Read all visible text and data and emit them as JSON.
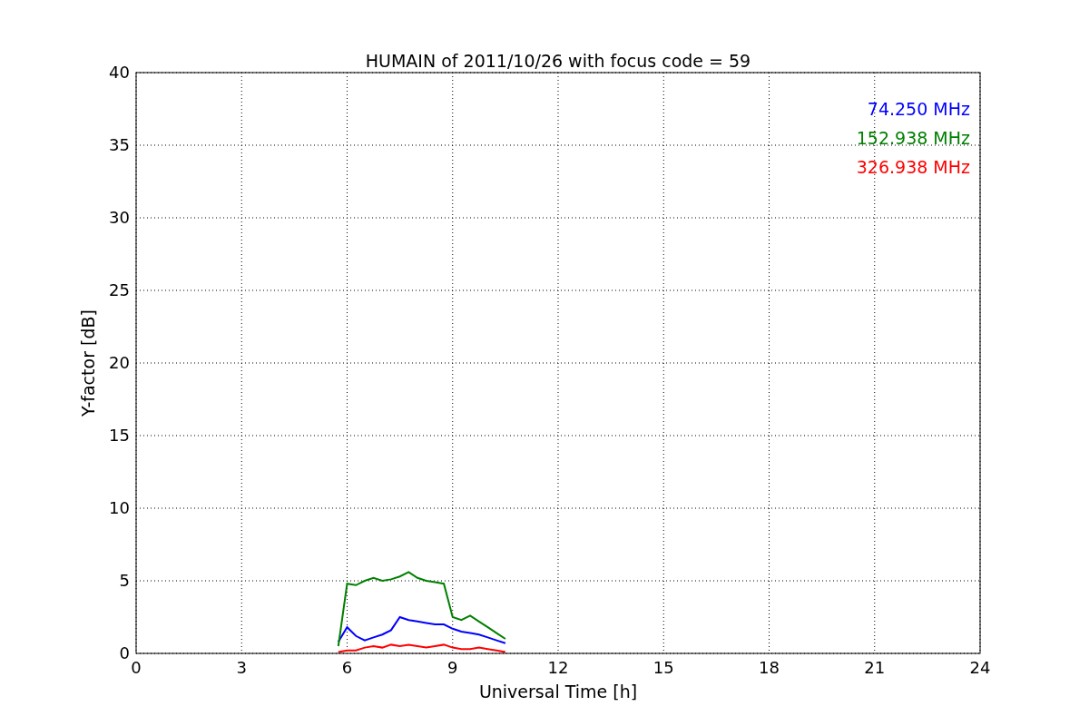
{
  "chart_data": {
    "type": "line",
    "title": "HUMAIN of 2011/10/26 with focus code = 59",
    "xlabel": "Universal Time [h]",
    "ylabel": "Y-factor [dB]",
    "x": [
      5.75,
      6.0,
      6.25,
      6.5,
      6.75,
      7.0,
      7.25,
      7.5,
      7.75,
      8.0,
      8.25,
      8.5,
      8.75,
      9.0,
      9.25,
      9.5,
      9.75,
      10.0,
      10.25,
      10.5
    ],
    "series": [
      {
        "name": "74.250 MHz",
        "color": "#0000ff",
        "values": [
          0.8,
          1.8,
          1.2,
          0.9,
          1.1,
          1.3,
          1.6,
          2.5,
          2.3,
          2.2,
          2.1,
          2.0,
          2.0,
          1.7,
          1.5,
          1.4,
          1.3,
          1.1,
          0.9,
          0.7
        ]
      },
      {
        "name": "152.938 MHz",
        "color": "#008000",
        "values": [
          0.5,
          4.8,
          4.7,
          5.0,
          5.2,
          5.0,
          5.1,
          5.3,
          5.6,
          5.2,
          5.0,
          4.9,
          4.8,
          2.5,
          2.3,
          2.6,
          2.2,
          1.8,
          1.4,
          1.0
        ]
      },
      {
        "name": "326.938 MHz",
        "color": "#ff0000",
        "values": [
          0.1,
          0.2,
          0.2,
          0.4,
          0.5,
          0.4,
          0.6,
          0.5,
          0.6,
          0.5,
          0.4,
          0.5,
          0.6,
          0.4,
          0.3,
          0.3,
          0.4,
          0.3,
          0.2,
          0.1
        ]
      }
    ],
    "grid": true,
    "xlim": [
      0,
      24
    ],
    "ylim": [
      0,
      40
    ],
    "xticks": [
      0,
      3,
      6,
      9,
      12,
      15,
      18,
      21,
      24
    ],
    "yticks": [
      0,
      5,
      10,
      15,
      20,
      25,
      30,
      35,
      40
    ]
  }
}
